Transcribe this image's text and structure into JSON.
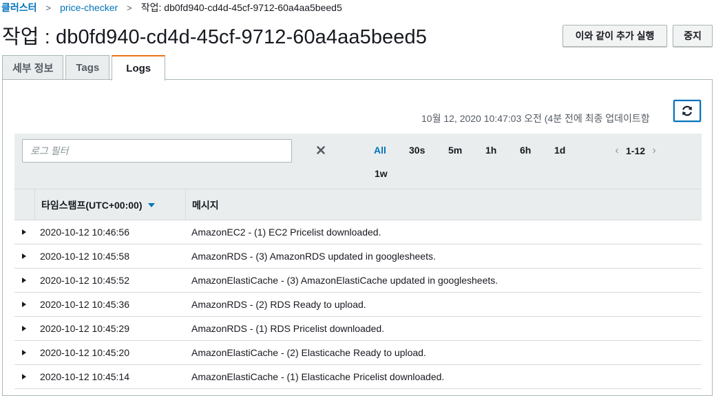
{
  "breadcrumb": {
    "items": [
      "클러스터",
      "price-checker",
      "작업: db0fd940-cd4d-45cf-9712-60a4aa5beed5"
    ]
  },
  "page": {
    "title": "작업 : db0fd940-cd4d-45cf-9712-60a4aa5beed5",
    "rerun_label": "이와 같이 추가 실행",
    "stop_label": "중지"
  },
  "tabs": [
    {
      "label": "세부 정보",
      "active": false
    },
    {
      "label": "Tags",
      "active": false
    },
    {
      "label": "Logs",
      "active": true
    }
  ],
  "logs": {
    "updated_text": "10월 12, 2020 10:47:03 오전 (4분 전에 최종 업데이트함",
    "refresh_icon": "refresh-icon",
    "filter_placeholder": "로그 필터",
    "ranges": [
      "All",
      "30s",
      "5m",
      "1h",
      "6h",
      "1d",
      "1w"
    ],
    "active_range": "All",
    "pagination": "1-12",
    "columns": [
      "타임스탬프(UTC+00:00)",
      "메시지"
    ],
    "sort": "descending",
    "rows": [
      {
        "timestamp": "2020-10-12 10:46:56",
        "message": "AmazonEC2 - (1) EC2 Pricelist downloaded."
      },
      {
        "timestamp": "2020-10-12 10:45:58",
        "message": "AmazonRDS - (3) AmazonRDS updated in googlesheets."
      },
      {
        "timestamp": "2020-10-12 10:45:52",
        "message": "AmazonElastiCache - (3) AmazonElastiCache updated in googlesheets."
      },
      {
        "timestamp": "2020-10-12 10:45:36",
        "message": "AmazonRDS - (2) RDS Ready to upload."
      },
      {
        "timestamp": "2020-10-12 10:45:29",
        "message": "AmazonRDS - (1) RDS Pricelist downloaded."
      },
      {
        "timestamp": "2020-10-12 10:45:20",
        "message": "AmazonElastiCache - (2) Elasticache Ready to upload."
      },
      {
        "timestamp": "2020-10-12 10:45:14",
        "message": "AmazonElastiCache - (1) Elasticache Pricelist downloaded."
      }
    ]
  },
  "colors": {
    "link": "#0073bb",
    "active_tab_accent": "#ec7211",
    "header_bg": "#eaeded"
  }
}
